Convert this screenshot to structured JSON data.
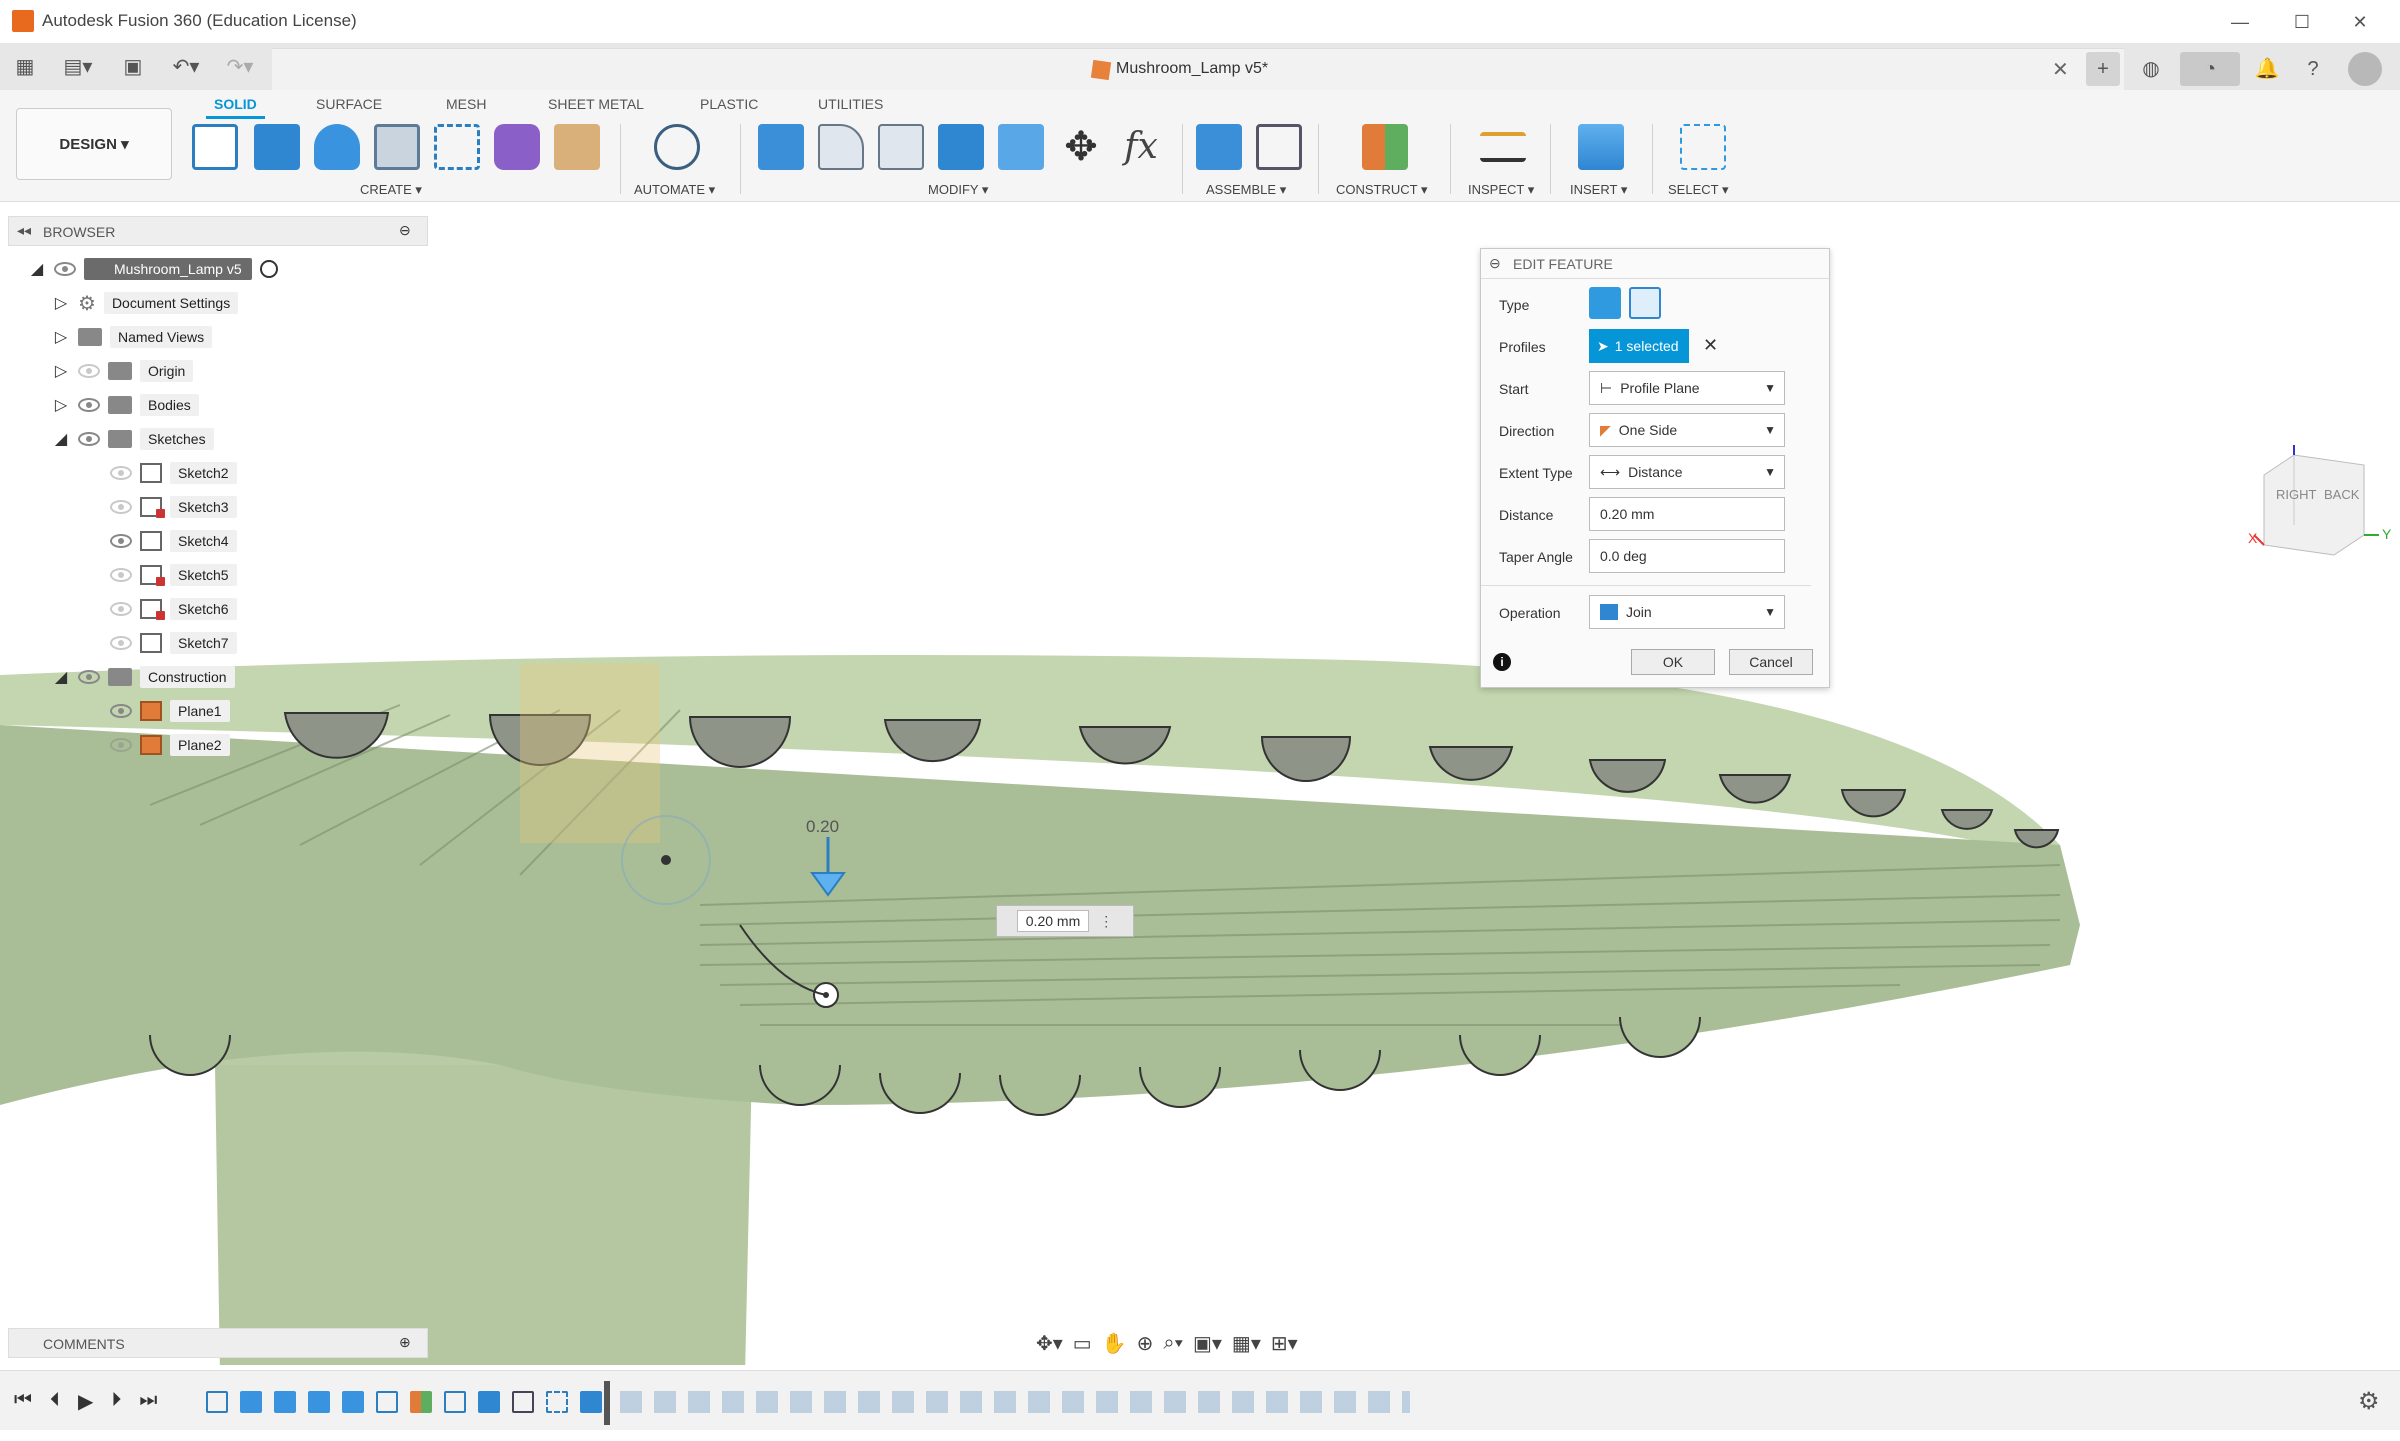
{
  "app": {
    "title": "Autodesk Fusion 360 (Education License)",
    "document_tab": "Mushroom_Lamp v5*"
  },
  "workspace": {
    "label": "DESIGN ▾"
  },
  "tabs": [
    "SOLID",
    "SURFACE",
    "MESH",
    "SHEET METAL",
    "PLASTIC",
    "UTILITIES"
  ],
  "groups": [
    "CREATE ▾",
    "AUTOMATE ▾",
    "MODIFY ▾",
    "ASSEMBLE ▾",
    "CONSTRUCT ▾",
    "INSPECT ▾",
    "INSERT ▾",
    "SELECT ▾"
  ],
  "browser": {
    "title": "BROWSER",
    "root": "Mushroom_Lamp v5",
    "items": [
      {
        "label": "Document Settings",
        "kind": "gear",
        "visible": true
      },
      {
        "label": "Named Views",
        "kind": "folder",
        "visible": true
      },
      {
        "label": "Origin",
        "kind": "folder",
        "visible": false
      },
      {
        "label": "Bodies",
        "kind": "folder",
        "visible": true
      },
      {
        "label": "Sketches",
        "kind": "folder",
        "visible": true
      }
    ],
    "sketches": [
      "Sketch2",
      "Sketch3",
      "Sketch4",
      "Sketch5",
      "Sketch6",
      "Sketch7"
    ],
    "construction": "Construction",
    "planes": [
      "Plane1",
      "Plane2"
    ]
  },
  "edit_feature": {
    "title": "EDIT FEATURE",
    "rows": [
      {
        "label": "Type"
      },
      {
        "label": "Profiles",
        "value": "1 selected"
      },
      {
        "label": "Start",
        "value": "Profile Plane"
      },
      {
        "label": "Direction",
        "value": "One Side"
      },
      {
        "label": "Extent Type",
        "value": "Distance"
      },
      {
        "label": "Distance",
        "value": "0.20 mm"
      },
      {
        "label": "Taper Angle",
        "value": "0.0 deg"
      },
      {
        "label": "Operation",
        "value": "Join"
      }
    ],
    "ok": "OK",
    "cancel": "Cancel"
  },
  "viewport": {
    "dim_label": "0.20",
    "dim_input": "0.20 mm"
  },
  "viewcube": {
    "right": "RIGHT",
    "back": "BACK"
  },
  "comments": {
    "title": "COMMENTS"
  },
  "colors": {
    "accent": "#0696d7",
    "model": "#a9be97"
  }
}
